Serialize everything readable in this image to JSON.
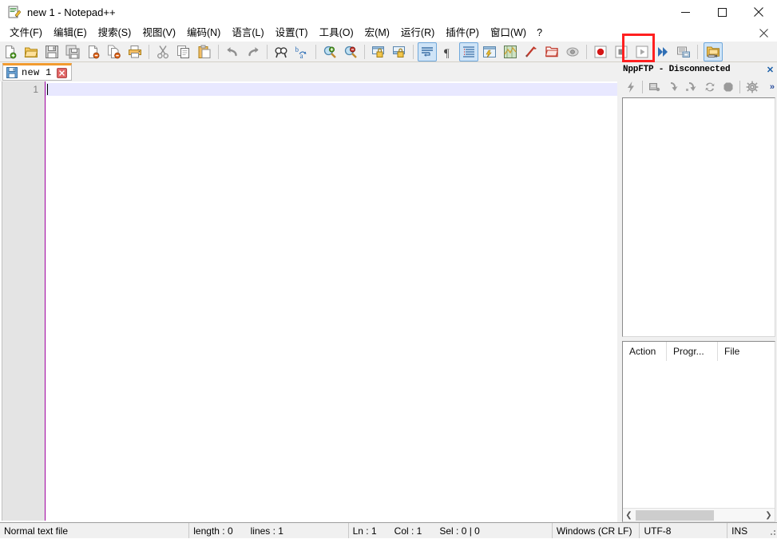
{
  "window": {
    "title": "new 1 - Notepad++",
    "app_icon": "notepad-plus-plus-icon",
    "controls": {
      "minimize": "minimize",
      "maximize": "maximize",
      "close": "close"
    }
  },
  "menubar": {
    "items": [
      {
        "label": "文件(F)",
        "name": "menu-file"
      },
      {
        "label": "编辑(E)",
        "name": "menu-edit"
      },
      {
        "label": "搜索(S)",
        "name": "menu-search"
      },
      {
        "label": "视图(V)",
        "name": "menu-view"
      },
      {
        "label": "编码(N)",
        "name": "menu-encoding"
      },
      {
        "label": "语言(L)",
        "name": "menu-language"
      },
      {
        "label": "设置(T)",
        "name": "menu-settings"
      },
      {
        "label": "工具(O)",
        "name": "menu-tools"
      },
      {
        "label": "宏(M)",
        "name": "menu-macro"
      },
      {
        "label": "运行(R)",
        "name": "menu-run"
      },
      {
        "label": "插件(P)",
        "name": "menu-plugins"
      },
      {
        "label": "窗口(W)",
        "name": "menu-window"
      },
      {
        "label": "?",
        "name": "menu-help"
      }
    ],
    "close_document": "✕"
  },
  "toolbar": {
    "buttons": [
      {
        "icon": "new-file-icon",
        "tip": "New"
      },
      {
        "icon": "open-file-icon",
        "tip": "Open"
      },
      {
        "icon": "save-icon",
        "tip": "Save"
      },
      {
        "icon": "save-all-icon",
        "tip": "Save All"
      },
      {
        "icon": "close-file-icon",
        "tip": "Close"
      },
      {
        "icon": "close-all-icon",
        "tip": "Close All"
      },
      {
        "icon": "print-icon",
        "tip": "Print"
      },
      {
        "icon": "cut-icon",
        "tip": "Cut"
      },
      {
        "icon": "copy-icon",
        "tip": "Copy"
      },
      {
        "icon": "paste-icon",
        "tip": "Paste"
      },
      {
        "icon": "undo-icon",
        "tip": "Undo"
      },
      {
        "icon": "redo-icon",
        "tip": "Redo"
      },
      {
        "icon": "find-icon",
        "tip": "Find"
      },
      {
        "icon": "replace-icon",
        "tip": "Replace"
      },
      {
        "icon": "zoom-in-icon",
        "tip": "Zoom In"
      },
      {
        "icon": "zoom-out-icon",
        "tip": "Zoom Out"
      },
      {
        "icon": "sync-vertical-icon",
        "tip": "Synchronize Vertical Scrolling"
      },
      {
        "icon": "sync-horizontal-icon",
        "tip": "Synchronize Horizontal Scrolling"
      },
      {
        "icon": "word-wrap-icon",
        "tip": "Word wrap",
        "toggled": true
      },
      {
        "icon": "show-all-characters-icon",
        "tip": "Show All Characters"
      },
      {
        "icon": "indent-guide-icon",
        "tip": "Show Indent Guide",
        "toggled": true
      },
      {
        "icon": "user-defined-language-icon",
        "tip": "User-Defined Dialogue"
      },
      {
        "icon": "document-map-icon",
        "tip": "Document Map"
      },
      {
        "icon": "function-list-icon",
        "tip": "Function List"
      },
      {
        "icon": "folder-as-workspace-icon",
        "tip": "Folder as Workspace"
      },
      {
        "icon": "monitoring-icon",
        "tip": "Monitoring"
      },
      {
        "icon": "record-macro-icon",
        "tip": "Start Recording"
      },
      {
        "icon": "stop-macro-icon",
        "tip": "Stop Recording"
      },
      {
        "icon": "play-macro-icon",
        "tip": "Playback"
      },
      {
        "icon": "run-macro-multiple-icon",
        "tip": "Run a Macro Multiple Times"
      },
      {
        "icon": "save-macro-icon",
        "tip": "Save Current Recorded Macro"
      },
      {
        "icon": "nppftp-icon",
        "tip": "Show NppFTP Window",
        "highlighted": true
      }
    ]
  },
  "highlight": {
    "color": "#ff2020",
    "target": "nppftp-toolbar-button"
  },
  "editor": {
    "tab": {
      "label": "new 1",
      "modified_icon": "save-icon",
      "close_icon": "close-icon"
    },
    "line_numbers": [
      "1"
    ],
    "content": "",
    "caret_line": 1
  },
  "ftp_panel": {
    "title": "NppFTP - Disconnected",
    "close_label": "✕",
    "toolbar": [
      {
        "icon": "connect-icon",
        "enabled": false
      },
      {
        "icon": "download-icon",
        "enabled": false
      },
      {
        "icon": "download-and-edit-icon",
        "enabled": false
      },
      {
        "icon": "upload-icon",
        "enabled": false
      },
      {
        "icon": "refresh-icon",
        "enabled": false
      },
      {
        "icon": "abort-icon",
        "enabled": false
      },
      {
        "icon": "settings-gear-icon",
        "enabled": true
      }
    ],
    "overflow_label": "»",
    "tree_items": [],
    "queue": {
      "columns": [
        "Action",
        "Progr...",
        "File"
      ],
      "rows": []
    },
    "scrollbar": {
      "left_arrow": "❮",
      "right_arrow": "❯"
    }
  },
  "statusbar": {
    "file_type": "Normal text file",
    "length_label": "length : 0",
    "lines_label": "lines : 1",
    "ln": "Ln : 1",
    "col": "Col : 1",
    "sel": "Sel : 0 | 0",
    "eol": "Windows (CR LF)",
    "encoding": "UTF-8",
    "insert_mode": "INS"
  },
  "colors": {
    "accent_tab": "#f29b2e",
    "toggled_button": "#cfe4f7",
    "active_line": "#e8e8ff",
    "gutter": "#e4e4e4",
    "highlight_box": "#ff2020"
  }
}
